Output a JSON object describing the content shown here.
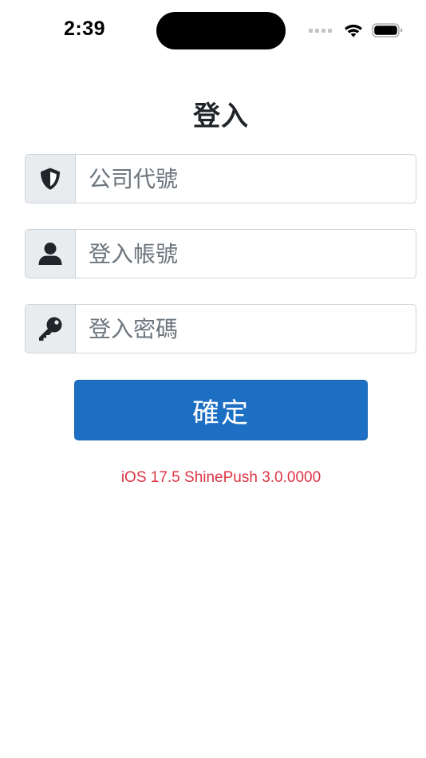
{
  "status_bar": {
    "time": "2:39",
    "icons": [
      "cellular-signal-icon",
      "wifi-icon",
      "battery-icon"
    ]
  },
  "login": {
    "title": "登入",
    "fields": [
      {
        "icon": "shield-icon",
        "placeholder": "公司代號",
        "value": ""
      },
      {
        "icon": "user-icon",
        "placeholder": "登入帳號",
        "value": ""
      },
      {
        "icon": "key-icon",
        "placeholder": "登入密碼",
        "value": ""
      }
    ],
    "confirm_label": "確定",
    "version": "iOS 17.5 ShinePush 3.0.0000"
  },
  "colors": {
    "primary": "#1d6fc4",
    "addon_bg": "#e9ecef",
    "border": "#ced4da",
    "version_text": "#dc3545",
    "placeholder": "#6c757d"
  }
}
